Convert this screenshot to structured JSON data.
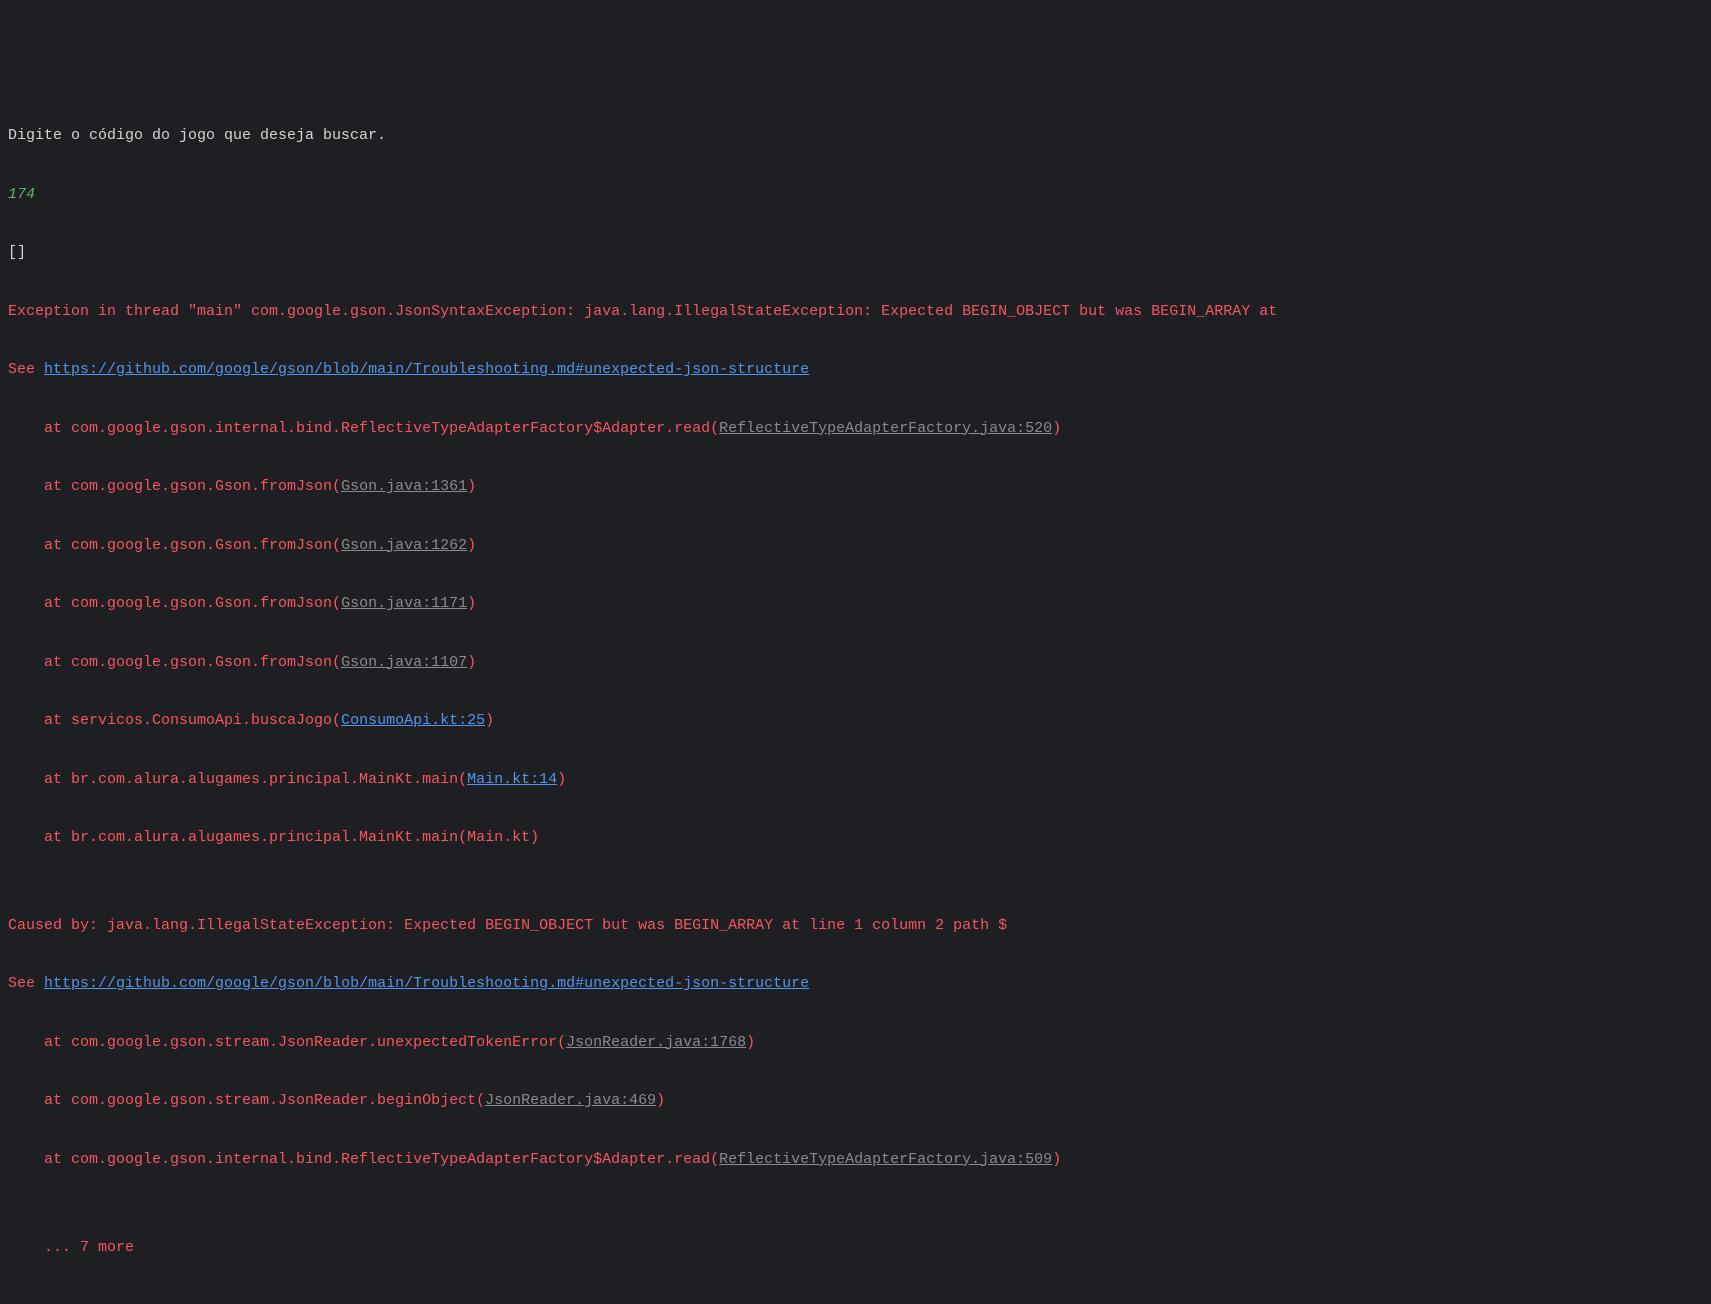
{
  "console": {
    "prompt": "Digite o código do jogo que deseja buscar.",
    "input": "174",
    "output": "[]",
    "exception_header": "Exception in thread \"main\" com.google.gson.JsonSyntaxException: java.lang.IllegalStateException: Expected BEGIN_OBJECT but was BEGIN_ARRAY at ",
    "see1_prefix": "See ",
    "see1_link": "https://github.com/google/gson/blob/main/Troubleshooting.md#unexpected-json-structure",
    "trace": [
      {
        "prefix": "    at com.google.gson.internal.bind.ReflectiveTypeAdapterFactory$Adapter.read(",
        "link": "ReflectiveTypeAdapterFactory.java:520",
        "link_class": "link-gray",
        "suffix": ")"
      },
      {
        "prefix": "    at com.google.gson.Gson.fromJson(",
        "link": "Gson.java:1361",
        "link_class": "link-gray",
        "suffix": ")"
      },
      {
        "prefix": "    at com.google.gson.Gson.fromJson(",
        "link": "Gson.java:1262",
        "link_class": "link-gray",
        "suffix": ")"
      },
      {
        "prefix": "    at com.google.gson.Gson.fromJson(",
        "link": "Gson.java:1171",
        "link_class": "link-gray",
        "suffix": ")"
      },
      {
        "prefix": "    at com.google.gson.Gson.fromJson(",
        "link": "Gson.java:1107",
        "link_class": "link-gray",
        "suffix": ")"
      },
      {
        "prefix": "    at servicos.ConsumoApi.buscaJogo(",
        "link": "ConsumoApi.kt:25",
        "link_class": "link-blue",
        "suffix": ")"
      },
      {
        "prefix": "    at br.com.alura.alugames.principal.MainKt.main(",
        "link": "Main.kt:14",
        "link_class": "link-blue",
        "suffix": ")"
      },
      {
        "prefix": "    at br.com.alura.alugames.principal.MainKt.main(Main.kt)",
        "link": "",
        "link_class": "",
        "suffix": ""
      }
    ],
    "caused_by": "Caused by: java.lang.IllegalStateException: Expected BEGIN_OBJECT but was BEGIN_ARRAY at line 1 column 2 path $",
    "see2_prefix": "See ",
    "see2_link": "https://github.com/google/gson/blob/main/Troubleshooting.md#unexpected-json-structure",
    "trace2": [
      {
        "prefix": "    at com.google.gson.stream.JsonReader.unexpectedTokenError(",
        "link": "JsonReader.java:1768",
        "link_class": "link-gray",
        "suffix": ")"
      },
      {
        "prefix": "    at com.google.gson.stream.JsonReader.beginObject(",
        "link": "JsonReader.java:469",
        "link_class": "link-gray",
        "suffix": ")"
      },
      {
        "prefix": "    at com.google.gson.internal.bind.ReflectiveTypeAdapterFactory$Adapter.read(",
        "link": "ReflectiveTypeAdapterFactory.java:509",
        "link_class": "link-gray",
        "suffix": ")"
      }
    ],
    "more": "    ... 7 more"
  }
}
